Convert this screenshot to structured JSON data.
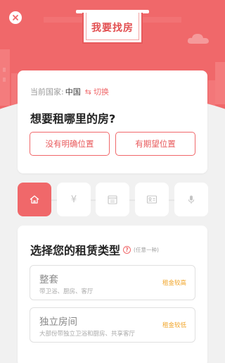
{
  "header": {
    "title": "我要找房",
    "colors": {
      "banner": "#f0686a",
      "accent": "#f0686a",
      "price": "#f1a52a"
    },
    "icons": {
      "close": "close-icon",
      "cloud": "cloud-icon"
    }
  },
  "country": {
    "label": "当前国家:",
    "value": "中国",
    "switch_label": "切换",
    "switch_icon": "⇆"
  },
  "location": {
    "question": "想要租哪里的房?",
    "options": [
      "没有明确位置",
      "有期望位置"
    ]
  },
  "steps": [
    {
      "icon": "home-icon",
      "active": true
    },
    {
      "icon": "yen-icon",
      "glyph": "¥",
      "active": false
    },
    {
      "icon": "calendar-icon",
      "active": false
    },
    {
      "icon": "id-card-icon",
      "active": false
    },
    {
      "icon": "microphone-icon",
      "active": false
    }
  ],
  "rental_type": {
    "title": "选择您的租赁类型",
    "help_glyph": "?",
    "hint": "(任意一种)",
    "options": [
      {
        "title": "整套",
        "desc": "带卫浴、厨房、客厅",
        "price": "租金较高"
      },
      {
        "title": "独立房间",
        "desc": "大部份带独立卫浴和厨房、共享客厅",
        "price": "租金较低"
      }
    ]
  }
}
